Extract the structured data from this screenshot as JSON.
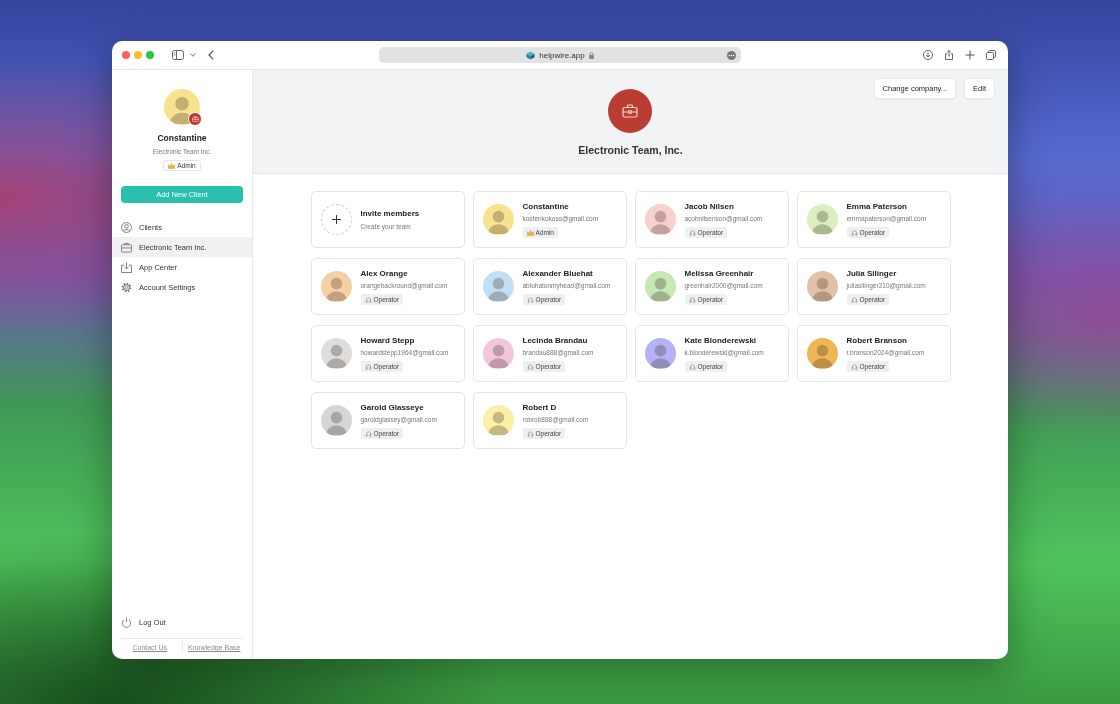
{
  "browser": {
    "url": "helpwire.app"
  },
  "sidebar": {
    "profile": {
      "name": "Constantine",
      "company": "Electronic Team Inc.",
      "role": "Admin"
    },
    "add_button": "Add New Client",
    "nav": [
      {
        "label": "Clients",
        "kind": "person",
        "selected": false
      },
      {
        "label": "Electronic Team Inc.",
        "kind": "briefcase",
        "selected": true
      },
      {
        "label": "App Center",
        "kind": "download",
        "selected": false
      },
      {
        "label": "Account Settings",
        "kind": "gear",
        "selected": false
      }
    ],
    "logout": "Log Out",
    "footer_links": [
      "Contact Us",
      "Knowledge Base"
    ]
  },
  "header": {
    "company": "Electronic Team, Inc.",
    "buttons": [
      "Change company...",
      "Edit"
    ]
  },
  "invite": {
    "title": "Invite members",
    "subtitle": "Create your team"
  },
  "members": [
    {
      "name": "Constantine",
      "email": "kostenkokoss@gmail.com",
      "role": "Admin",
      "kind": "admin",
      "color": "#f7e38f"
    },
    {
      "name": "Jacob Nilsen",
      "email": "acobnilsenson@gmail.com",
      "role": "Operator",
      "kind": "operator",
      "color": "#f8d0cf"
    },
    {
      "name": "Emma Paterson",
      "email": "emmapaterson@gmail.com",
      "role": "Operator",
      "kind": "operator",
      "color": "#d9efbf"
    },
    {
      "name": "Alex Orange",
      "email": "orangebackround@gmail.com",
      "role": "Operator",
      "kind": "operator",
      "color": "#f7cfa5"
    },
    {
      "name": "Alexander Bluehat",
      "email": "abluhatonmyhead@gmail.com",
      "role": "Operator",
      "kind": "operator",
      "color": "#c2e0f4"
    },
    {
      "name": "Melissa Greenhair",
      "email": "greenhair2000@gmail.com",
      "role": "Operator",
      "kind": "operator",
      "color": "#c5e8b5"
    },
    {
      "name": "Julia Silinger",
      "email": "juliasilinger210@gmail.com",
      "role": "Operator",
      "kind": "operator",
      "color": "#e2c1a8"
    },
    {
      "name": "Howard Stepp",
      "email": "howardstepp1964@gmail.com",
      "role": "Operator",
      "kind": "operator",
      "color": "#dddddd"
    },
    {
      "name": "Lecinda Brandau",
      "email": "brandau888@gmail.com",
      "role": "Operator",
      "kind": "operator",
      "color": "#f2c7dd"
    },
    {
      "name": "Kate Blonderewski",
      "email": "k.blonderewski@gmail.com",
      "role": "Operator",
      "kind": "operator",
      "color": "#b4b3f6"
    },
    {
      "name": "Robert Branson",
      "email": "r.branson2024@gmail.com",
      "role": "Operator",
      "kind": "operator",
      "color": "#efb655"
    },
    {
      "name": "Garold Glasseye",
      "email": "garoldglassey@gmail.com",
      "role": "Operator",
      "kind": "operator",
      "color": "#d6d6d6"
    },
    {
      "name": "Robert D",
      "email": "robrob888@gmail.com",
      "role": "Operator",
      "kind": "operator",
      "color": "#fbf0a8"
    }
  ]
}
